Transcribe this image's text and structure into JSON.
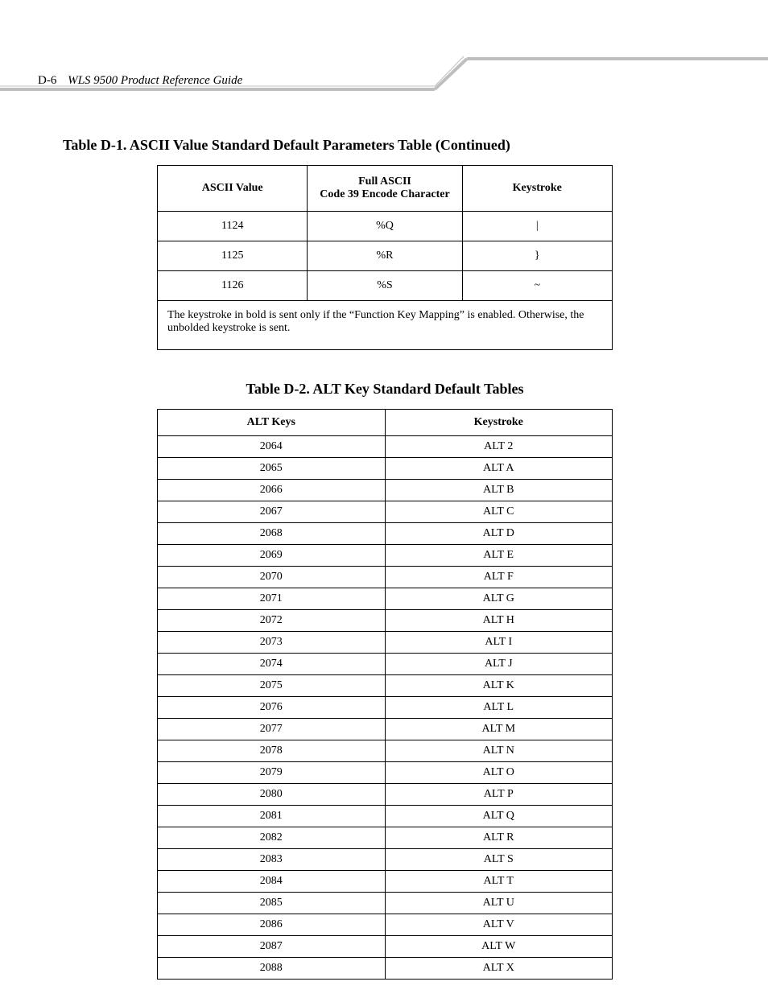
{
  "header": {
    "page_number": "D-6",
    "guide_title": "WLS 9500 Product Reference Guide"
  },
  "table1": {
    "title": "Table D-1.  ASCII Value Standard Default Parameters Table (Continued)",
    "headers": {
      "col1": "ASCII Value",
      "col2_line1": "Full ASCII",
      "col2_line2": "Code 39 Encode Character",
      "col3": "Keystroke"
    },
    "rows": [
      {
        "ascii": "1124",
        "encode": "%Q",
        "keystroke": "|"
      },
      {
        "ascii": "1125",
        "encode": "%R",
        "keystroke": "}"
      },
      {
        "ascii": "1126",
        "encode": "%S",
        "keystroke": "~"
      }
    ],
    "footnote": "The keystroke in bold is sent only if the “Function Key Mapping” is enabled. Otherwise, the unbolded keystroke is sent."
  },
  "table2": {
    "title": "Table D-2. ALT Key Standard Default Tables",
    "headers": {
      "col1": "ALT Keys",
      "col2": "Keystroke"
    },
    "rows": [
      {
        "key": "2064",
        "stroke": "ALT 2"
      },
      {
        "key": "2065",
        "stroke": "ALT A"
      },
      {
        "key": "2066",
        "stroke": "ALT B"
      },
      {
        "key": "2067",
        "stroke": "ALT C"
      },
      {
        "key": "2068",
        "stroke": "ALT D"
      },
      {
        "key": "2069",
        "stroke": "ALT E"
      },
      {
        "key": "2070",
        "stroke": "ALT F"
      },
      {
        "key": "2071",
        "stroke": "ALT G"
      },
      {
        "key": "2072",
        "stroke": "ALT H"
      },
      {
        "key": "2073",
        "stroke": "ALT I"
      },
      {
        "key": "2074",
        "stroke": "ALT J"
      },
      {
        "key": "2075",
        "stroke": "ALT K"
      },
      {
        "key": "2076",
        "stroke": "ALT L"
      },
      {
        "key": "2077",
        "stroke": "ALT M"
      },
      {
        "key": "2078",
        "stroke": "ALT N"
      },
      {
        "key": "2079",
        "stroke": "ALT O"
      },
      {
        "key": "2080",
        "stroke": "ALT P"
      },
      {
        "key": "2081",
        "stroke": "ALT Q"
      },
      {
        "key": "2082",
        "stroke": "ALT R"
      },
      {
        "key": "2083",
        "stroke": "ALT S"
      },
      {
        "key": "2084",
        "stroke": "ALT T"
      },
      {
        "key": "2085",
        "stroke": "ALT U"
      },
      {
        "key": "2086",
        "stroke": "ALT V"
      },
      {
        "key": "2087",
        "stroke": "ALT W"
      },
      {
        "key": "2088",
        "stroke": "ALT X"
      }
    ]
  }
}
